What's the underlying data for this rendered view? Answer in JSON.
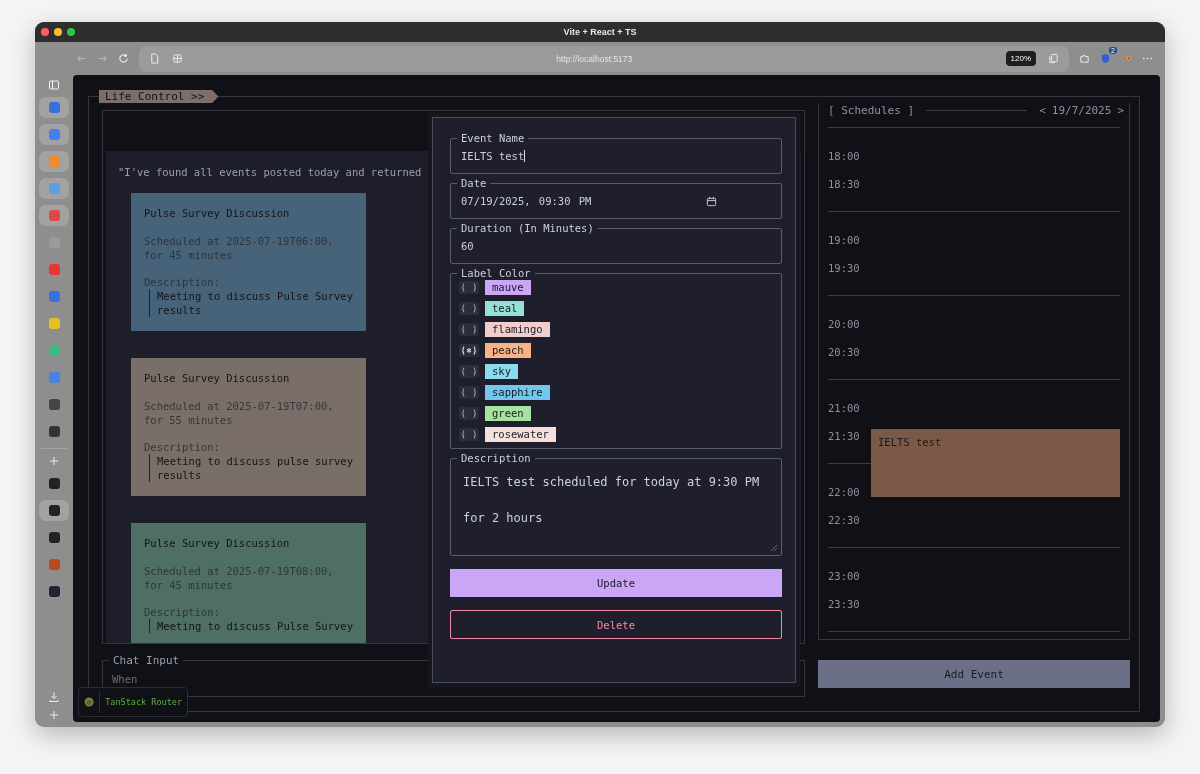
{
  "browser": {
    "title": "Vite + React + TS",
    "url": "http://localhost:5173",
    "zoom": "120%",
    "extension_badge": "2"
  },
  "app": {
    "title": "Life Control >>",
    "chat_log": {
      "message": "\"I've found all events posted today and returned",
      "events": [
        {
          "title": "Pulse Survey Discussion",
          "scheduled": "Scheduled at 2025-07-19T06:00,\nfor 45 minutes",
          "description_label": "Description:",
          "description": "Meeting to discuss Pulse Survey results",
          "color": "#46637a"
        },
        {
          "title": "Pulse Survey Discussion",
          "scheduled": "Scheduled at 2025-07-19T07:00,\nfor 55 minutes",
          "description_label": "Description:",
          "description": "Meeting to discuss pulse survey results",
          "color": "#7a6e69"
        },
        {
          "title": "Pulse Survey Discussion",
          "scheduled": "Scheduled at 2025-07-19T08:00,\nfor 45 minutes",
          "description_label": "Description:",
          "description": "Meeting to discuss Pulse Survey",
          "color": "#4f6e64"
        }
      ]
    },
    "chat_input": {
      "label": "Chat Input",
      "placeholder": "When"
    },
    "schedules": {
      "title": "[ Schedules ]",
      "prev": "<",
      "date": "19/7/2025",
      "next": ">",
      "hours": [
        {
          "times": [
            {
              "label": "18:00"
            },
            {
              "label": "18:30"
            }
          ]
        },
        {
          "times": [
            {
              "label": "19:00"
            },
            {
              "label": "19:30"
            }
          ]
        },
        {
          "times": [
            {
              "label": "20:00"
            },
            {
              "label": "20:30"
            }
          ]
        },
        {
          "times": [
            {
              "label": "21:00"
            },
            {
              "label": "21:30",
              "events": [
                {
                  "title": "IELTS test",
                  "color": "#7a5a46"
                }
              ]
            }
          ]
        },
        {
          "times": [
            {
              "label": "22:00"
            },
            {
              "label": "22:30"
            }
          ]
        },
        {
          "times": [
            {
              "label": "23:00"
            },
            {
              "label": "23:30"
            }
          ]
        }
      ]
    },
    "add_event": "Add Event"
  },
  "event_dialog": {
    "name_label": "Event Name",
    "name_value": "IELTS test",
    "date_label": "Date",
    "date_value": "07/19/2025, 09:30 PM",
    "duration_label": "Duration (In Minutes)",
    "duration_value": "60",
    "color_label": "Label Color",
    "colors": [
      {
        "name": "mauve",
        "color": "#cba6f7",
        "selected": false
      },
      {
        "name": "teal",
        "color": "#94e2d5",
        "selected": false
      },
      {
        "name": "flamingo",
        "color": "#f2cdcd",
        "selected": false
      },
      {
        "name": "peach",
        "color": "#fab387",
        "selected": true
      },
      {
        "name": "sky",
        "color": "#89dceb",
        "selected": false
      },
      {
        "name": "sapphire",
        "color": "#74c7ec",
        "selected": false
      },
      {
        "name": "green",
        "color": "#a6e3a1",
        "selected": false
      },
      {
        "name": "rosewater",
        "color": "#f5e0dc",
        "selected": false
      }
    ],
    "description_label": "Description",
    "description_value": "IELTS test scheduled for today at 9:30 PM for 2 hours",
    "update": "Update",
    "delete": "Delete"
  },
  "devtools": {
    "label": "TanStack Router"
  }
}
